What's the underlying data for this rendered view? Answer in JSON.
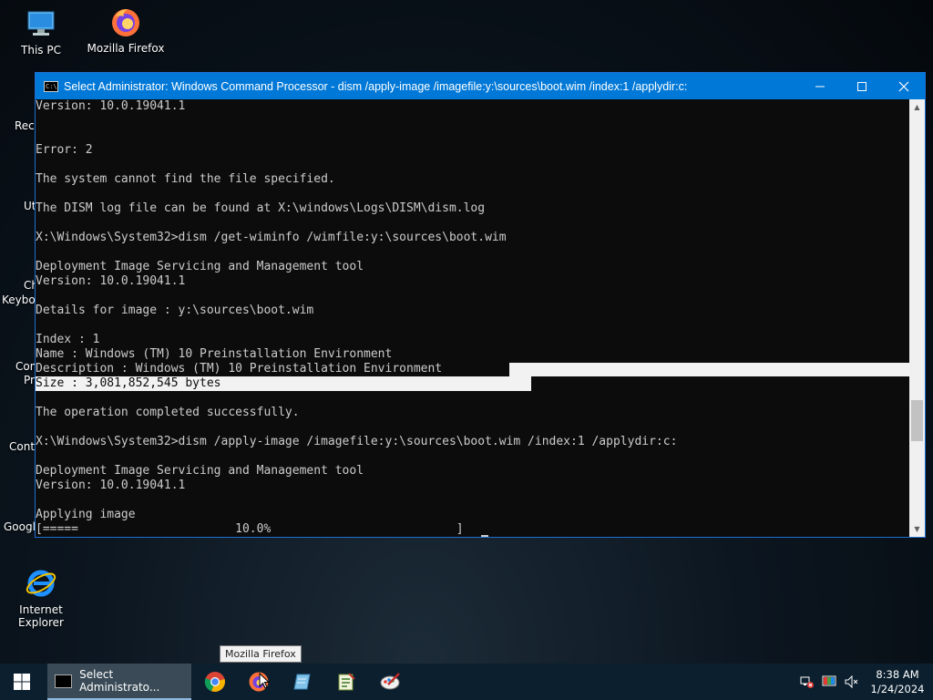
{
  "desktop": {
    "icons": [
      {
        "label": "This PC"
      },
      {
        "label": "Mozilla Firefox"
      },
      {
        "label": "Internet Explorer"
      }
    ],
    "partial_labels": [
      "Recy",
      "Ut",
      "Ch",
      "Keyboa",
      "Con",
      "Pr",
      "Contr",
      "Google"
    ]
  },
  "window": {
    "title": "Select Administrator: Windows Command Processor - dism  /apply-image /imagefile:y:\\sources\\boot.wim /index:1 /applydir:c:",
    "icon_label": "C:\\",
    "minimize": "—",
    "maximize": "☐",
    "close": "✕"
  },
  "console": {
    "lines": [
      "Version: 10.0.19041.1",
      "",
      "",
      "Error: 2",
      "",
      "The system cannot find the file specified.",
      "",
      "The DISM log file can be found at X:\\windows\\Logs\\DISM\\dism.log",
      "",
      "X:\\Windows\\System32>dism /get-wiminfo /wimfile:y:\\sources\\boot.wim",
      "",
      "Deployment Image Servicing and Management tool",
      "Version: 10.0.19041.1",
      "",
      "Details for image : y:\\sources\\boot.wim",
      "",
      "Index : 1",
      "Name : Windows (TM) 10 Preinstallation Environment",
      "Description : Windows (TM) 10 Preinstallation Environment",
      "Size : 3,081,852,545 bytes",
      "",
      "The operation completed successfully.",
      "",
      "X:\\Windows\\System32>dism /apply-image /imagefile:y:\\sources\\boot.wim /index:1 /applydir:c:",
      "",
      "Deployment Image Servicing and Management tool",
      "Version: 10.0.19041.1",
      "",
      "Applying image",
      "[=====                      10.0%                          ] "
    ]
  },
  "taskbar": {
    "task_label": "Select Administrato...",
    "tooltip": "Mozilla Firefox",
    "clock_time": "8:38 AM",
    "clock_date": "1/24/2024"
  }
}
